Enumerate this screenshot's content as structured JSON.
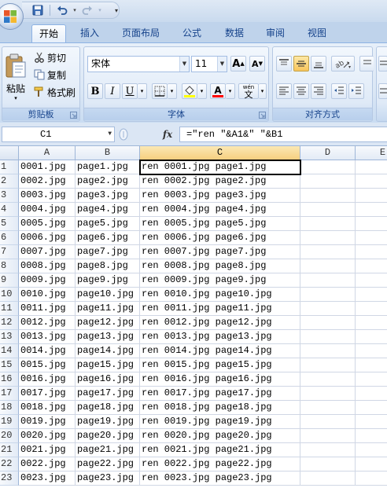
{
  "ribbon_tabs": [
    "开始",
    "插入",
    "页面布局",
    "公式",
    "数据",
    "审阅",
    "视图"
  ],
  "clipboard": {
    "paste_label": "粘贴",
    "cut_label": "剪切",
    "copy_label": "复制",
    "format_painter_label": "格式刷",
    "group_label": "剪贴板"
  },
  "font": {
    "name": "宋体",
    "size": "11",
    "grow_label": "A",
    "shrink_label": "A",
    "bold_label": "B",
    "italic_label": "I",
    "underline_label": "U",
    "color_label": "A",
    "phonetic_label": "wén",
    "phonetic_char": "文",
    "group_label": "字体",
    "fill_color": "#ffff00",
    "font_color": "#ff0000"
  },
  "alignment": {
    "group_label": "对齐方式"
  },
  "formula_bar": {
    "name_box": "C1",
    "fx_label": "fx",
    "formula": "=\"ren \"&A1&\" \"&B1"
  },
  "columns": [
    "A",
    "B",
    "C",
    "D",
    "E"
  ],
  "rows": [
    {
      "num": "1",
      "a": "0001.jpg",
      "b": "page1.jpg",
      "c": "ren 0001.jpg page1.jpg"
    },
    {
      "num": "2",
      "a": "0002.jpg",
      "b": "page2.jpg",
      "c": "ren 0002.jpg page2.jpg"
    },
    {
      "num": "3",
      "a": "0003.jpg",
      "b": "page3.jpg",
      "c": "ren 0003.jpg page3.jpg"
    },
    {
      "num": "4",
      "a": "0004.jpg",
      "b": "page4.jpg",
      "c": "ren 0004.jpg page4.jpg"
    },
    {
      "num": "5",
      "a": "0005.jpg",
      "b": "page5.jpg",
      "c": "ren 0005.jpg page5.jpg"
    },
    {
      "num": "6",
      "a": "0006.jpg",
      "b": "page6.jpg",
      "c": "ren 0006.jpg page6.jpg"
    },
    {
      "num": "7",
      "a": "0007.jpg",
      "b": "page7.jpg",
      "c": "ren 0007.jpg page7.jpg"
    },
    {
      "num": "8",
      "a": "0008.jpg",
      "b": "page8.jpg",
      "c": "ren 0008.jpg page8.jpg"
    },
    {
      "num": "9",
      "a": "0009.jpg",
      "b": "page9.jpg",
      "c": "ren 0009.jpg page9.jpg"
    },
    {
      "num": "10",
      "a": "0010.jpg",
      "b": "page10.jpg",
      "c": "ren 0010.jpg page10.jpg"
    },
    {
      "num": "11",
      "a": "0011.jpg",
      "b": "page11.jpg",
      "c": "ren 0011.jpg page11.jpg"
    },
    {
      "num": "12",
      "a": "0012.jpg",
      "b": "page12.jpg",
      "c": "ren 0012.jpg page12.jpg"
    },
    {
      "num": "13",
      "a": "0013.jpg",
      "b": "page13.jpg",
      "c": "ren 0013.jpg page13.jpg"
    },
    {
      "num": "14",
      "a": "0014.jpg",
      "b": "page14.jpg",
      "c": "ren 0014.jpg page14.jpg"
    },
    {
      "num": "15",
      "a": "0015.jpg",
      "b": "page15.jpg",
      "c": "ren 0015.jpg page15.jpg"
    },
    {
      "num": "16",
      "a": "0016.jpg",
      "b": "page16.jpg",
      "c": "ren 0016.jpg page16.jpg"
    },
    {
      "num": "17",
      "a": "0017.jpg",
      "b": "page17.jpg",
      "c": "ren 0017.jpg page17.jpg"
    },
    {
      "num": "18",
      "a": "0018.jpg",
      "b": "page18.jpg",
      "c": "ren 0018.jpg page18.jpg"
    },
    {
      "num": "19",
      "a": "0019.jpg",
      "b": "page19.jpg",
      "c": "ren 0019.jpg page19.jpg"
    },
    {
      "num": "20",
      "a": "0020.jpg",
      "b": "page20.jpg",
      "c": "ren 0020.jpg page20.jpg"
    },
    {
      "num": "21",
      "a": "0021.jpg",
      "b": "page21.jpg",
      "c": "ren 0021.jpg page21.jpg"
    },
    {
      "num": "22",
      "a": "0022.jpg",
      "b": "page22.jpg",
      "c": "ren 0022.jpg page22.jpg"
    },
    {
      "num": "23",
      "a": "0023.jpg",
      "b": "page23.jpg",
      "c": "ren 0023.jpg page23.jpg"
    }
  ]
}
